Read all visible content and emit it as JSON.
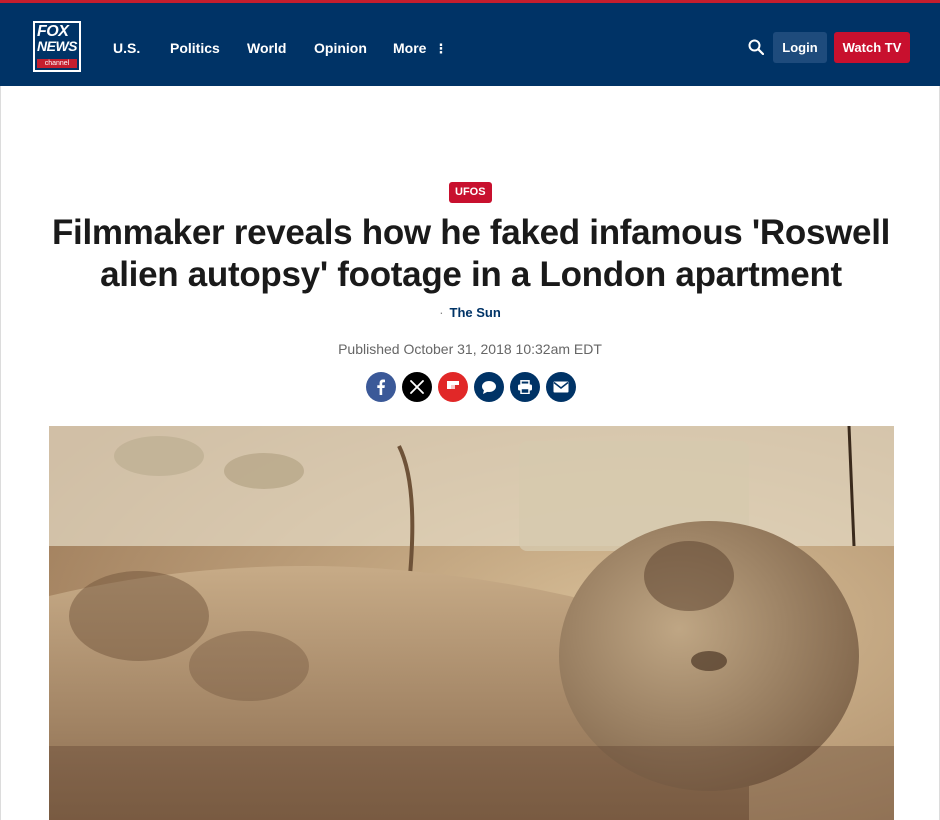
{
  "header": {
    "logo": {
      "line1": "FOX",
      "line2": "NEWS",
      "line3": "channel"
    },
    "nav": [
      {
        "label": "U.S."
      },
      {
        "label": "Politics"
      },
      {
        "label": "World"
      },
      {
        "label": "Opinion"
      },
      {
        "label": "More"
      }
    ],
    "search_icon": "search-icon",
    "login_label": "Login",
    "watch_tv_label": "Watch TV"
  },
  "article": {
    "category": "UFOS",
    "headline": "Filmmaker reveals how he faked infamous 'Roswell alien autopsy' footage in a London apartment",
    "byline_separator": "·",
    "source": "The Sun",
    "published": "Published October 31, 2018 10:32am EDT",
    "share": [
      {
        "icon": "facebook-icon",
        "color": "#3b5998"
      },
      {
        "icon": "x-icon",
        "color": "#000000"
      },
      {
        "icon": "flipboard-icon",
        "color": "#e12828"
      },
      {
        "icon": "comments-icon",
        "color": "#003366"
      },
      {
        "icon": "print-icon",
        "color": "#003366"
      },
      {
        "icon": "email-icon",
        "color": "#003366"
      }
    ]
  },
  "colors": {
    "nav_background": "#003366",
    "brand_red": "#c8102e",
    "login_button": "#1e4b7c"
  }
}
